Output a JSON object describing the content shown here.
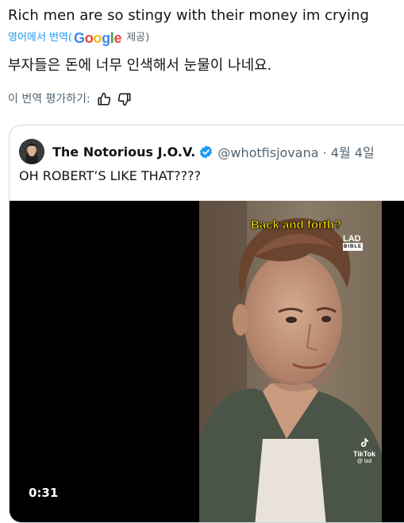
{
  "tweet": {
    "text": "Rich men are so stingy with their money im crying",
    "translate": {
      "label": "영어에서 번역",
      "open_paren": "(",
      "provider_letters": [
        "G",
        "o",
        "o",
        "g",
        "l",
        "e"
      ],
      "provided": "제공)"
    },
    "translated_text": "부자들은 돈에 너무 인색해서 눈물이 나네요.",
    "rate_label": "이 번역 평가하기:"
  },
  "quote": {
    "name": "The Notorious J.O.V.",
    "handle_date": "@whotfisjovana · 4월 4일",
    "text": "OH ROBERT’S LIKE THAT????",
    "video": {
      "duration": "0:31",
      "caption": "Back and forth?",
      "watermark_top": "LAD",
      "watermark_bottom": "BIBLE",
      "tiktok_label": "TikTok",
      "tiktok_handle": "@ lad"
    }
  },
  "colors": {
    "link": "#1d9bf0",
    "muted": "#536471",
    "verified": "#1d9bf0",
    "caption": "#ffe600"
  }
}
